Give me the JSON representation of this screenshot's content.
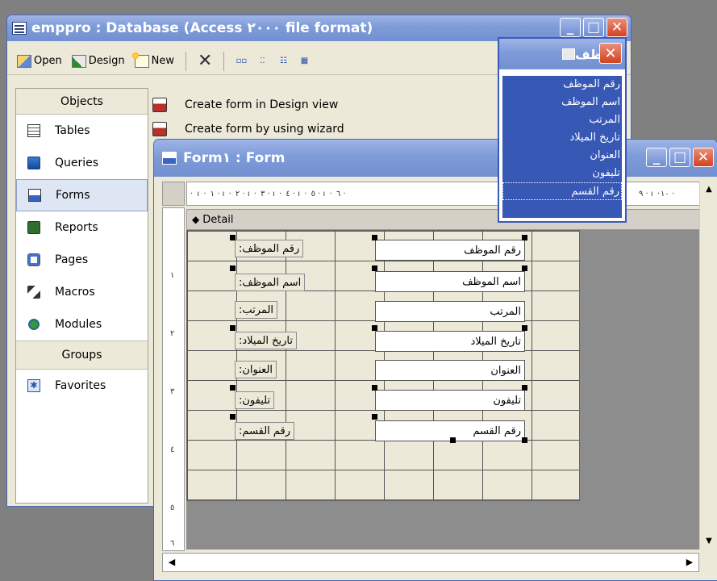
{
  "db_window": {
    "title": "emppro : Database (Access ٢٠٠٠ file format)",
    "toolbar": {
      "open": "Open",
      "design": "Design",
      "new": "New"
    },
    "objects_header": "Objects",
    "objects": [
      "Tables",
      "Queries",
      "Forms",
      "Reports",
      "Pages",
      "Macros",
      "Modules"
    ],
    "selected_object": "Forms",
    "groups_header": "Groups",
    "groups": [
      "Favorites"
    ],
    "create_items": [
      "Create form in Design view",
      "Create form by using wizard"
    ]
  },
  "form_window": {
    "title": "Form١ : Form",
    "section": "Detail",
    "ruler_top": "· ı · ١ · ı · ٢ · ı · ٣ · ı · ٤ · ı · ٥ · ı · ٦ ·",
    "ruler_top_right": "٩ · ı ·١٠ ·",
    "ruler_left": [
      "١",
      "٢",
      "٣",
      "٤",
      "٥",
      "٦"
    ],
    "controls": [
      {
        "label": "رقم الموظف:",
        "textbox": "رقم الموظف"
      },
      {
        "label": "اسم الموظف:",
        "textbox": "اسم الموظف"
      },
      {
        "label": "المرتب:",
        "textbox": "المرتب"
      },
      {
        "label": "تاريخ الميلاد:",
        "textbox": "تاريخ الميلاد"
      },
      {
        "label": "العنوان:",
        "textbox": "العنوان"
      },
      {
        "label": "تليفون:",
        "textbox": "تليفون"
      },
      {
        "label": "رقم القسم:",
        "textbox": "رقم القسم"
      }
    ]
  },
  "field_list": {
    "title": "موظف",
    "fields": [
      "رقم الموظف",
      "اسم الموظف",
      "المرتب",
      "تاريخ الميلاد",
      "العنوان",
      "تليفون",
      "رقم القسم"
    ],
    "active_field": "رقم القسم"
  },
  "colors": {
    "titlebar": "#7e9bd9",
    "close_button": "#d2421f",
    "field_list_bg": "#3758b5",
    "window_face": "#ece9d8"
  }
}
